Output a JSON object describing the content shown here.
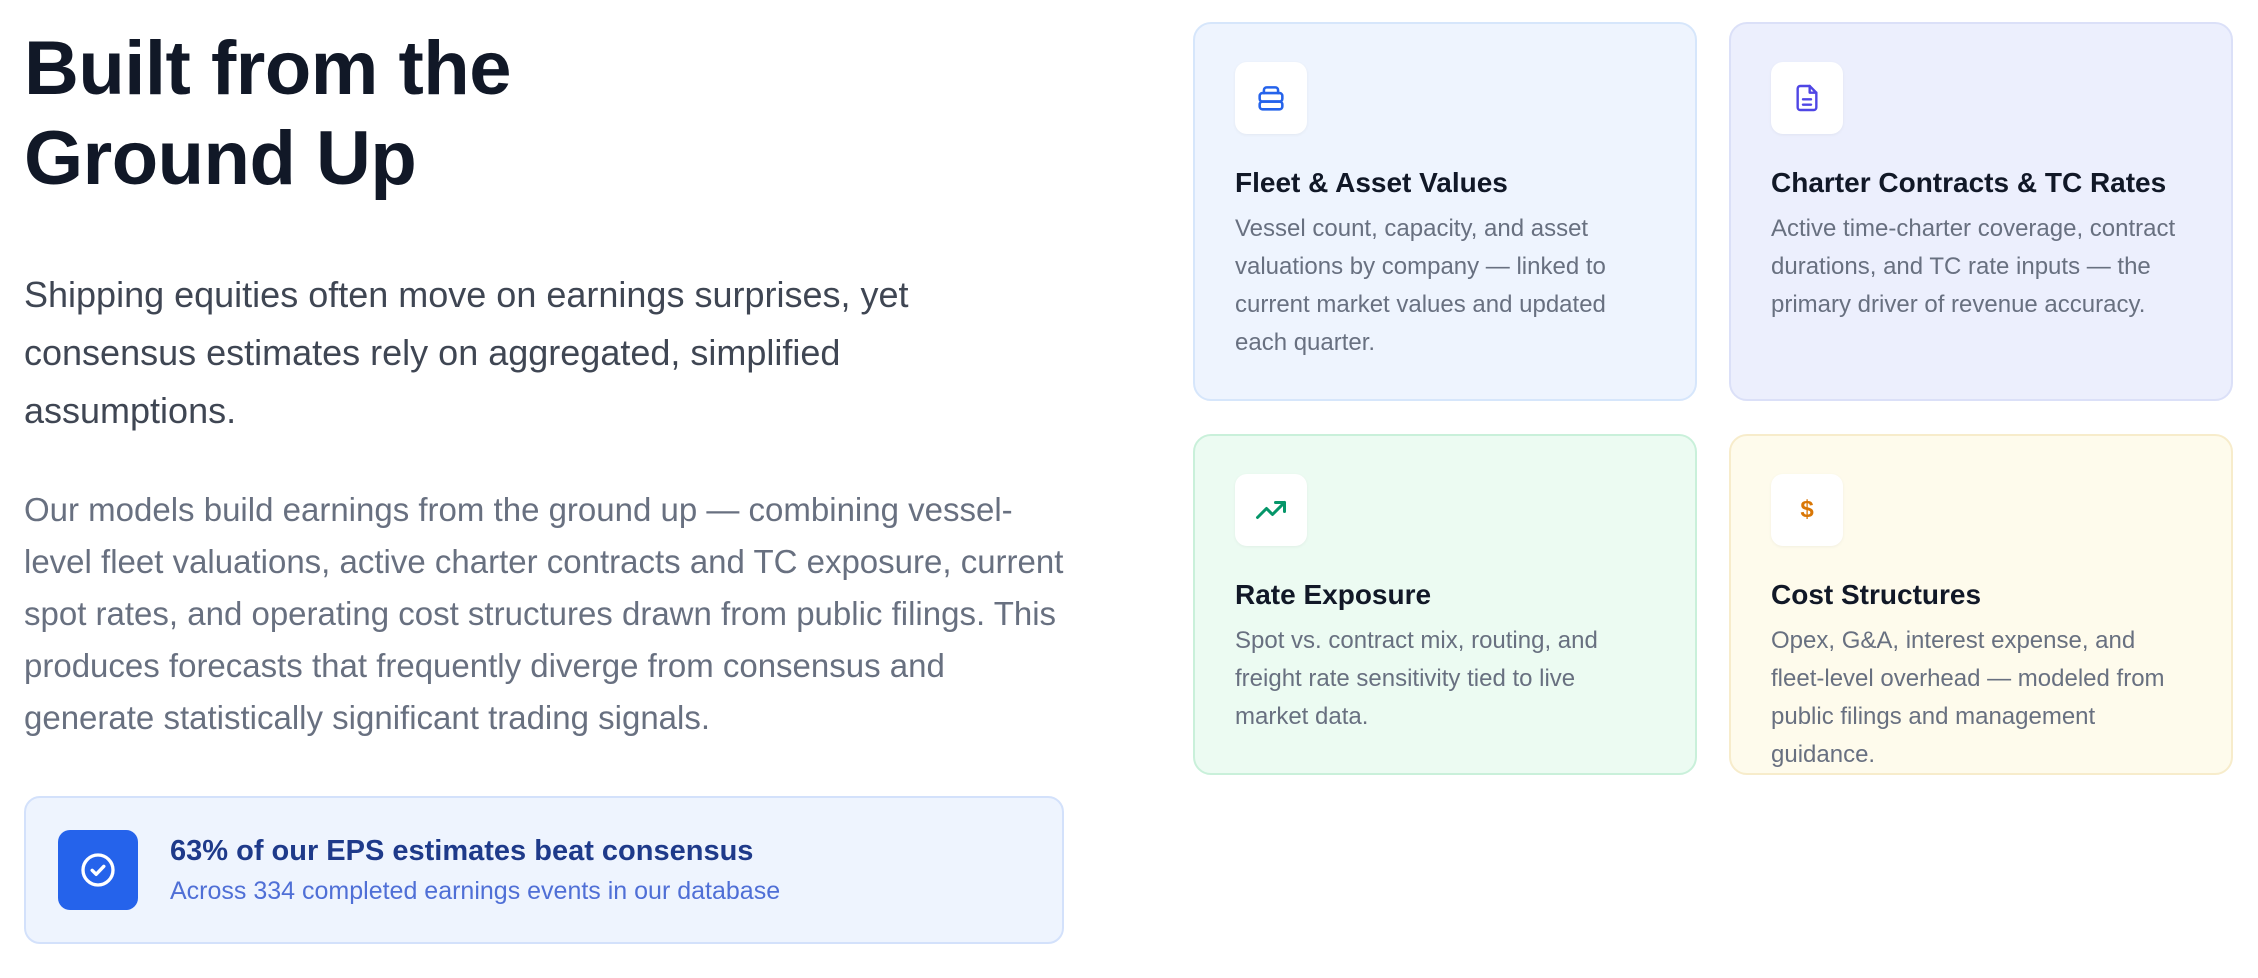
{
  "hero": {
    "headline_line1": "Built from the",
    "headline_line2": "Ground Up",
    "lead": "Shipping equities often move on earnings surprises, yet consensus estimates rely on aggregated, simplified assumptions.",
    "body": "Our models build earnings from the ground up — combining vessel-level fleet valuations, active charter contracts and TC exposure, current spot rates, and operating cost structures drawn from public filings. This produces forecasts that frequently diverge from consensus and generate statistically significant trading signals."
  },
  "stat": {
    "icon": "check-circle-icon",
    "title": "63% of our EPS estimates beat consensus",
    "subtitle": "Across 334 completed earnings events in our database",
    "accent": "#2563eb"
  },
  "cards": [
    {
      "icon": "layers-stack-icon",
      "icon_color": "#2563eb",
      "title": "Fleet & Asset Values",
      "description": "Vessel count, capacity, and asset valuations by company — linked to current market values and updated each quarter."
    },
    {
      "icon": "document-icon",
      "icon_color": "#4f46e5",
      "title": "Charter Contracts & TC Rates",
      "description": "Active time-charter coverage, contract durations, and TC rate inputs — the primary driver of revenue accuracy."
    },
    {
      "icon": "trending-up-icon",
      "icon_color": "#059669",
      "title": "Rate Exposure",
      "description": "Spot vs. contract mix, routing, and freight rate sensitivity tied to live market data."
    },
    {
      "icon": "dollar-icon",
      "icon_glyph": "$",
      "icon_color": "#d97706",
      "title": "Cost Structures",
      "description": "Opex, G&A, interest expense, and fleet-level overhead — modeled from public filings and management guidance."
    }
  ]
}
